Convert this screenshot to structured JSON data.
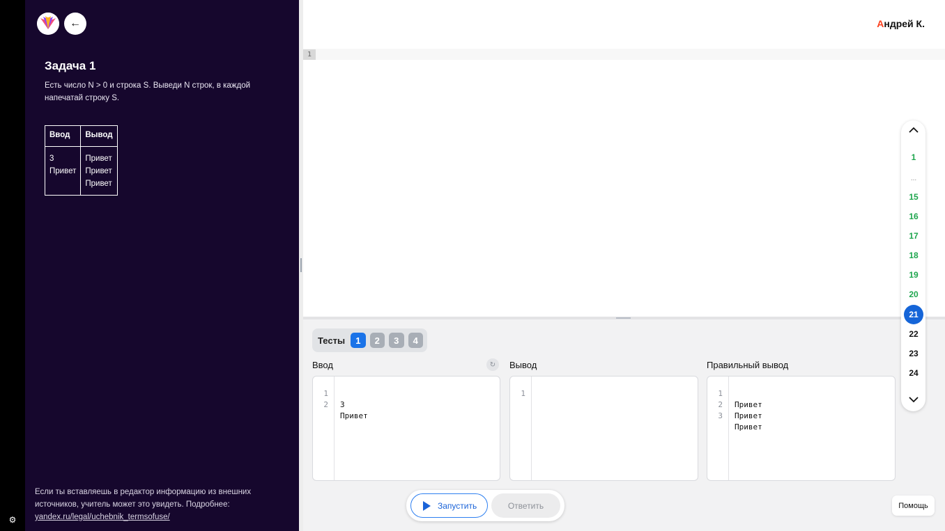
{
  "user": {
    "name_first_letter": "А",
    "name_rest": "ндрей К."
  },
  "task": {
    "title": "Задача 1",
    "description": "Есть число N > 0 и строка S. Выведи N строк, в каждой напечатай строку S.",
    "table": {
      "headers": [
        "Ввод",
        "Вывод"
      ],
      "input_lines": [
        "3",
        "Привет"
      ],
      "output_lines": [
        "Привет",
        "Привет",
        "Привет"
      ]
    }
  },
  "notice": {
    "text": "Если ты вставляешь в редактор информацию из внешних источников, учитель может это увидеть. Подробнее: ",
    "link_text": "yandex.ru/legal/uchebnik_termsofuse/"
  },
  "editor": {
    "line_number": "1"
  },
  "tests": {
    "label": "Тесты",
    "tabs": [
      "1",
      "2",
      "3",
      "4"
    ],
    "active": "1"
  },
  "panels": {
    "input": {
      "label": "Ввод",
      "lines": [
        {
          "n": "1",
          "t": "3"
        },
        {
          "n": "2",
          "t": "Привет"
        }
      ]
    },
    "output": {
      "label": "Вывод",
      "lines": [
        {
          "n": "1",
          "t": ""
        }
      ]
    },
    "expected": {
      "label": "Правильный вывод",
      "lines": [
        {
          "n": "1",
          "t": "Привет"
        },
        {
          "n": "2",
          "t": "Привет"
        },
        {
          "n": "3",
          "t": "Привет"
        }
      ]
    }
  },
  "actions": {
    "run_label": "Запустить",
    "answer_label": "Ответить"
  },
  "help_label": "Помощь",
  "task_nav": {
    "items": [
      {
        "label": "1",
        "state": "done"
      },
      {
        "label": "...",
        "state": "ellipsis"
      },
      {
        "label": "15",
        "state": "done"
      },
      {
        "label": "16",
        "state": "done"
      },
      {
        "label": "17",
        "state": "done"
      },
      {
        "label": "18",
        "state": "done"
      },
      {
        "label": "19",
        "state": "done"
      },
      {
        "label": "20",
        "state": "done"
      },
      {
        "label": "21",
        "state": "current"
      },
      {
        "label": "22",
        "state": "todo"
      },
      {
        "label": "23",
        "state": "todo"
      },
      {
        "label": "24",
        "state": "todo"
      }
    ]
  },
  "colors": {
    "accent": "#1565d8",
    "done": "#1fa64e",
    "sidebar": "#16072d",
    "brand_letter": "#fc3f1d"
  }
}
